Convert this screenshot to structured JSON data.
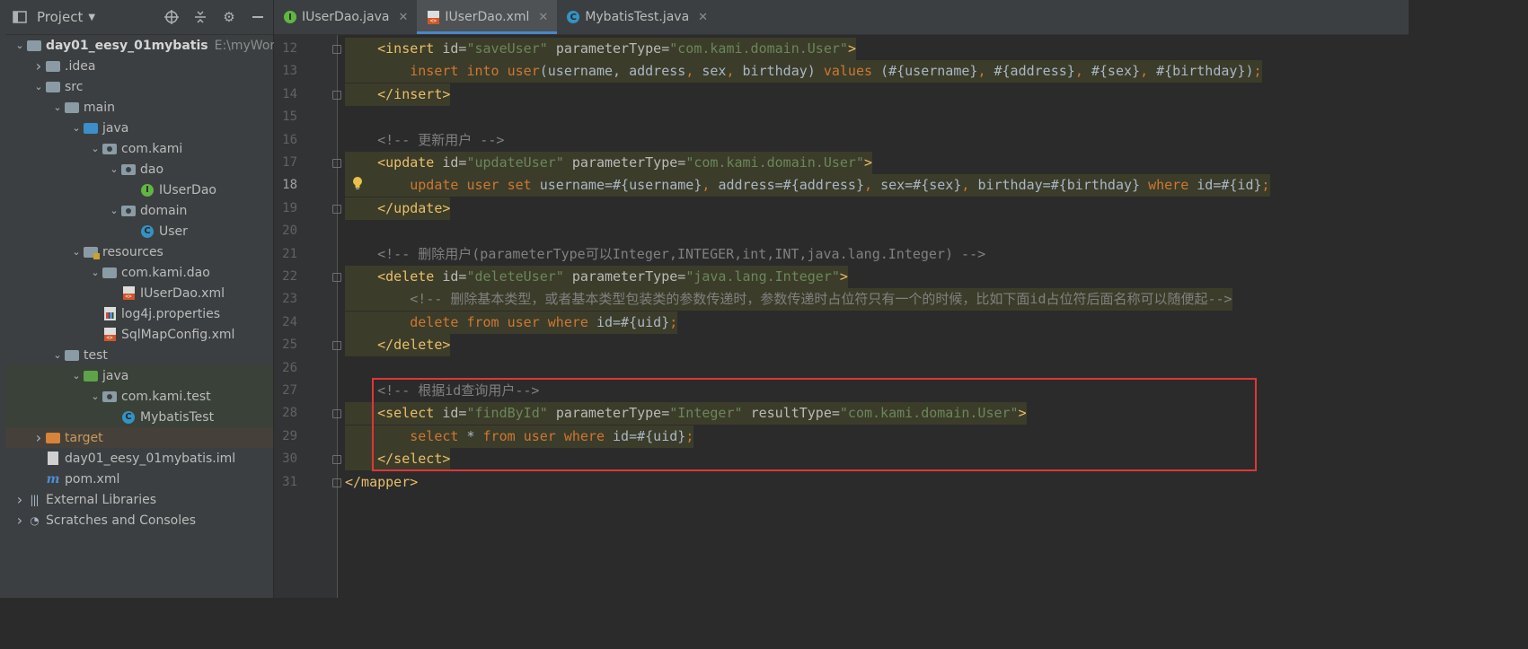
{
  "project_panel": {
    "title": "Project",
    "tree": [
      {
        "label": "day01_eesy_01mybatis",
        "path": "E:\\myWork\\V",
        "depth": 0,
        "arrow": "down",
        "icon": "module-folder-icon",
        "bold": true
      },
      {
        "label": ".idea",
        "depth": 1,
        "arrow": "right",
        "icon": "folder-icon"
      },
      {
        "label": "src",
        "depth": 1,
        "arrow": "down",
        "icon": "folder-icon"
      },
      {
        "label": "main",
        "depth": 2,
        "arrow": "down",
        "icon": "folder-icon"
      },
      {
        "label": "java",
        "depth": 3,
        "arrow": "down",
        "icon": "source-folder-icon"
      },
      {
        "label": "com.kami",
        "depth": 4,
        "arrow": "down",
        "icon": "package-icon"
      },
      {
        "label": "dao",
        "depth": 5,
        "arrow": "down",
        "icon": "package-icon"
      },
      {
        "label": "IUserDao",
        "depth": 6,
        "arrow": "",
        "icon": "interface-icon"
      },
      {
        "label": "domain",
        "depth": 5,
        "arrow": "down",
        "icon": "package-icon"
      },
      {
        "label": "User",
        "depth": 6,
        "arrow": "",
        "icon": "class-icon"
      },
      {
        "label": "resources",
        "depth": 3,
        "arrow": "down",
        "icon": "resources-folder-icon"
      },
      {
        "label": "com.kami.dao",
        "depth": 4,
        "arrow": "down",
        "icon": "folder-icon"
      },
      {
        "label": "IUserDao.xml",
        "depth": 5,
        "arrow": "",
        "icon": "xml-file-icon"
      },
      {
        "label": "log4j.properties",
        "depth": 4,
        "arrow": "",
        "icon": "properties-file-icon"
      },
      {
        "label": "SqlMapConfig.xml",
        "depth": 4,
        "arrow": "",
        "icon": "xml-file-icon"
      },
      {
        "label": "test",
        "depth": 2,
        "arrow": "down",
        "icon": "folder-icon"
      },
      {
        "label": "java",
        "depth": 3,
        "arrow": "down",
        "icon": "test-source-folder-icon",
        "highlight": "green"
      },
      {
        "label": "com.kami.test",
        "depth": 4,
        "arrow": "down",
        "icon": "package-icon",
        "highlight": "green"
      },
      {
        "label": "MybatisTest",
        "depth": 5,
        "arrow": "",
        "icon": "test-class-icon",
        "highlight": "green"
      },
      {
        "label": "target",
        "depth": 1,
        "arrow": "right",
        "icon": "excluded-folder-icon",
        "highlight": "orange"
      },
      {
        "label": "day01_eesy_01mybatis.iml",
        "depth": 1,
        "arrow": "",
        "icon": "iml-file-icon"
      },
      {
        "label": "pom.xml",
        "depth": 1,
        "arrow": "",
        "icon": "maven-icon"
      },
      {
        "label": "External Libraries",
        "depth": 0,
        "arrow": "right",
        "icon": "libraries-icon"
      },
      {
        "label": "Scratches and Consoles",
        "depth": 0,
        "arrow": "right",
        "icon": "scratches-icon"
      }
    ]
  },
  "tabs": [
    {
      "label": "IUserDao.java",
      "icon": "interface-icon",
      "active": false
    },
    {
      "label": "IUserDao.xml",
      "icon": "xml-file-icon",
      "active": true
    },
    {
      "label": "MybatisTest.java",
      "icon": "test-class-icon",
      "active": false
    }
  ],
  "editor": {
    "current_line": 18,
    "lines": [
      {
        "n": 12,
        "highlight": true,
        "parts": [
          [
            "tx",
            "    "
          ],
          [
            "tg",
            "<insert "
          ],
          [
            "at",
            "id="
          ],
          [
            "st",
            "\"saveUser\" "
          ],
          [
            "at",
            "parameterType="
          ],
          [
            "st",
            "\"com.kami.domain.User\""
          ],
          [
            "tg",
            ">"
          ]
        ]
      },
      {
        "n": 13,
        "highlight": true,
        "parts": [
          [
            "tx",
            "        "
          ],
          [
            "kw",
            "insert into "
          ],
          [
            "kw",
            "user"
          ],
          [
            "tx",
            "(username, address"
          ],
          [
            "kw",
            ", "
          ],
          [
            "tx",
            "sex"
          ],
          [
            "kw",
            ", "
          ],
          [
            "tx",
            "birthday) "
          ],
          [
            "kw",
            "values "
          ],
          [
            "tx",
            "(#{username}"
          ],
          [
            "kw",
            ", "
          ],
          [
            "tx",
            "#{address}"
          ],
          [
            "kw",
            ", "
          ],
          [
            "tx",
            "#{sex}"
          ],
          [
            "kw",
            ", "
          ],
          [
            "tx",
            "#{birthday})"
          ],
          [
            "kw",
            ";"
          ]
        ]
      },
      {
        "n": 14,
        "highlight": true,
        "parts": [
          [
            "tx",
            "    "
          ],
          [
            "tg",
            "</insert>"
          ]
        ]
      },
      {
        "n": 15,
        "highlight": false,
        "parts": []
      },
      {
        "n": 16,
        "highlight": false,
        "parts": [
          [
            "tx",
            "    "
          ],
          [
            "cm",
            "<!-- 更新用户 -->"
          ]
        ]
      },
      {
        "n": 17,
        "highlight": true,
        "parts": [
          [
            "tx",
            "    "
          ],
          [
            "tg",
            "<update "
          ],
          [
            "at",
            "id="
          ],
          [
            "st",
            "\"updateUser\" "
          ],
          [
            "at",
            "parameterType="
          ],
          [
            "st",
            "\"com.kami.domain.User\""
          ],
          [
            "tg",
            ">"
          ]
        ]
      },
      {
        "n": 18,
        "highlight": true,
        "parts": [
          [
            "tx",
            "        "
          ],
          [
            "kw",
            "update "
          ],
          [
            "kw",
            "user "
          ],
          [
            "kw",
            "set "
          ],
          [
            "tx",
            "username=#{username}"
          ],
          [
            "kw",
            ", "
          ],
          [
            "tx",
            "address=#{address}"
          ],
          [
            "kw",
            ", "
          ],
          [
            "tx",
            "sex=#{sex}"
          ],
          [
            "kw",
            ", "
          ],
          [
            "tx",
            "birthday=#{birthday} "
          ],
          [
            "kw",
            "where "
          ],
          [
            "tx",
            "id=#{id}"
          ],
          [
            "kw",
            ";"
          ]
        ]
      },
      {
        "n": 19,
        "highlight": true,
        "parts": [
          [
            "tx",
            "    "
          ],
          [
            "tg",
            "</update>"
          ]
        ]
      },
      {
        "n": 20,
        "highlight": false,
        "parts": []
      },
      {
        "n": 21,
        "highlight": false,
        "parts": [
          [
            "tx",
            "    "
          ],
          [
            "cm",
            "<!-- 删除用户(parameterType可以Integer,INTEGER,int,INT,java.lang.Integer) -->"
          ]
        ]
      },
      {
        "n": 22,
        "highlight": true,
        "parts": [
          [
            "tx",
            "    "
          ],
          [
            "tg",
            "<delete "
          ],
          [
            "at",
            "id="
          ],
          [
            "st",
            "\"deleteUser\" "
          ],
          [
            "at",
            "parameterType="
          ],
          [
            "st",
            "\"java.lang.Integer\""
          ],
          [
            "tg",
            ">"
          ]
        ]
      },
      {
        "n": 23,
        "highlight": true,
        "parts": [
          [
            "tx",
            "        "
          ],
          [
            "cm",
            "<!-- 删除基本类型，或者基本类型包装类的参数传递时，参数传递时占位符只有一个的时候，比如下面id占位符后面名称可以随便起-->"
          ]
        ]
      },
      {
        "n": 24,
        "highlight": true,
        "parts": [
          [
            "tx",
            "        "
          ],
          [
            "kw",
            "delete from "
          ],
          [
            "kw",
            "user "
          ],
          [
            "kw",
            "where "
          ],
          [
            "tx",
            "id=#{uid}"
          ],
          [
            "kw",
            ";"
          ]
        ]
      },
      {
        "n": 25,
        "highlight": true,
        "parts": [
          [
            "tx",
            "    "
          ],
          [
            "tg",
            "</delete>"
          ]
        ]
      },
      {
        "n": 26,
        "highlight": false,
        "parts": []
      },
      {
        "n": 27,
        "highlight": false,
        "parts": [
          [
            "tx",
            "    "
          ],
          [
            "cm",
            "<!-- 根据id查询用户-->"
          ]
        ]
      },
      {
        "n": 28,
        "highlight": true,
        "parts": [
          [
            "tx",
            "    "
          ],
          [
            "tg",
            "<select "
          ],
          [
            "at",
            "id="
          ],
          [
            "st",
            "\"findById\" "
          ],
          [
            "at",
            "parameterType="
          ],
          [
            "st",
            "\"Integer\" "
          ],
          [
            "at",
            "resultType="
          ],
          [
            "st",
            "\"com.kami.domain.User\""
          ],
          [
            "tg",
            ">"
          ]
        ]
      },
      {
        "n": 29,
        "highlight": true,
        "parts": [
          [
            "tx",
            "        "
          ],
          [
            "kw",
            "select "
          ],
          [
            "tx",
            "* "
          ],
          [
            "kw",
            "from "
          ],
          [
            "kw",
            "user "
          ],
          [
            "kw",
            "where "
          ],
          [
            "tx",
            "id=#{uid}"
          ],
          [
            "kw",
            ";"
          ]
        ]
      },
      {
        "n": 30,
        "highlight": true,
        "parts": [
          [
            "tx",
            "    "
          ],
          [
            "tg",
            "</select>"
          ]
        ]
      },
      {
        "n": 31,
        "highlight": false,
        "parts": [
          [
            "tg",
            "</mapper>"
          ]
        ]
      }
    ]
  }
}
